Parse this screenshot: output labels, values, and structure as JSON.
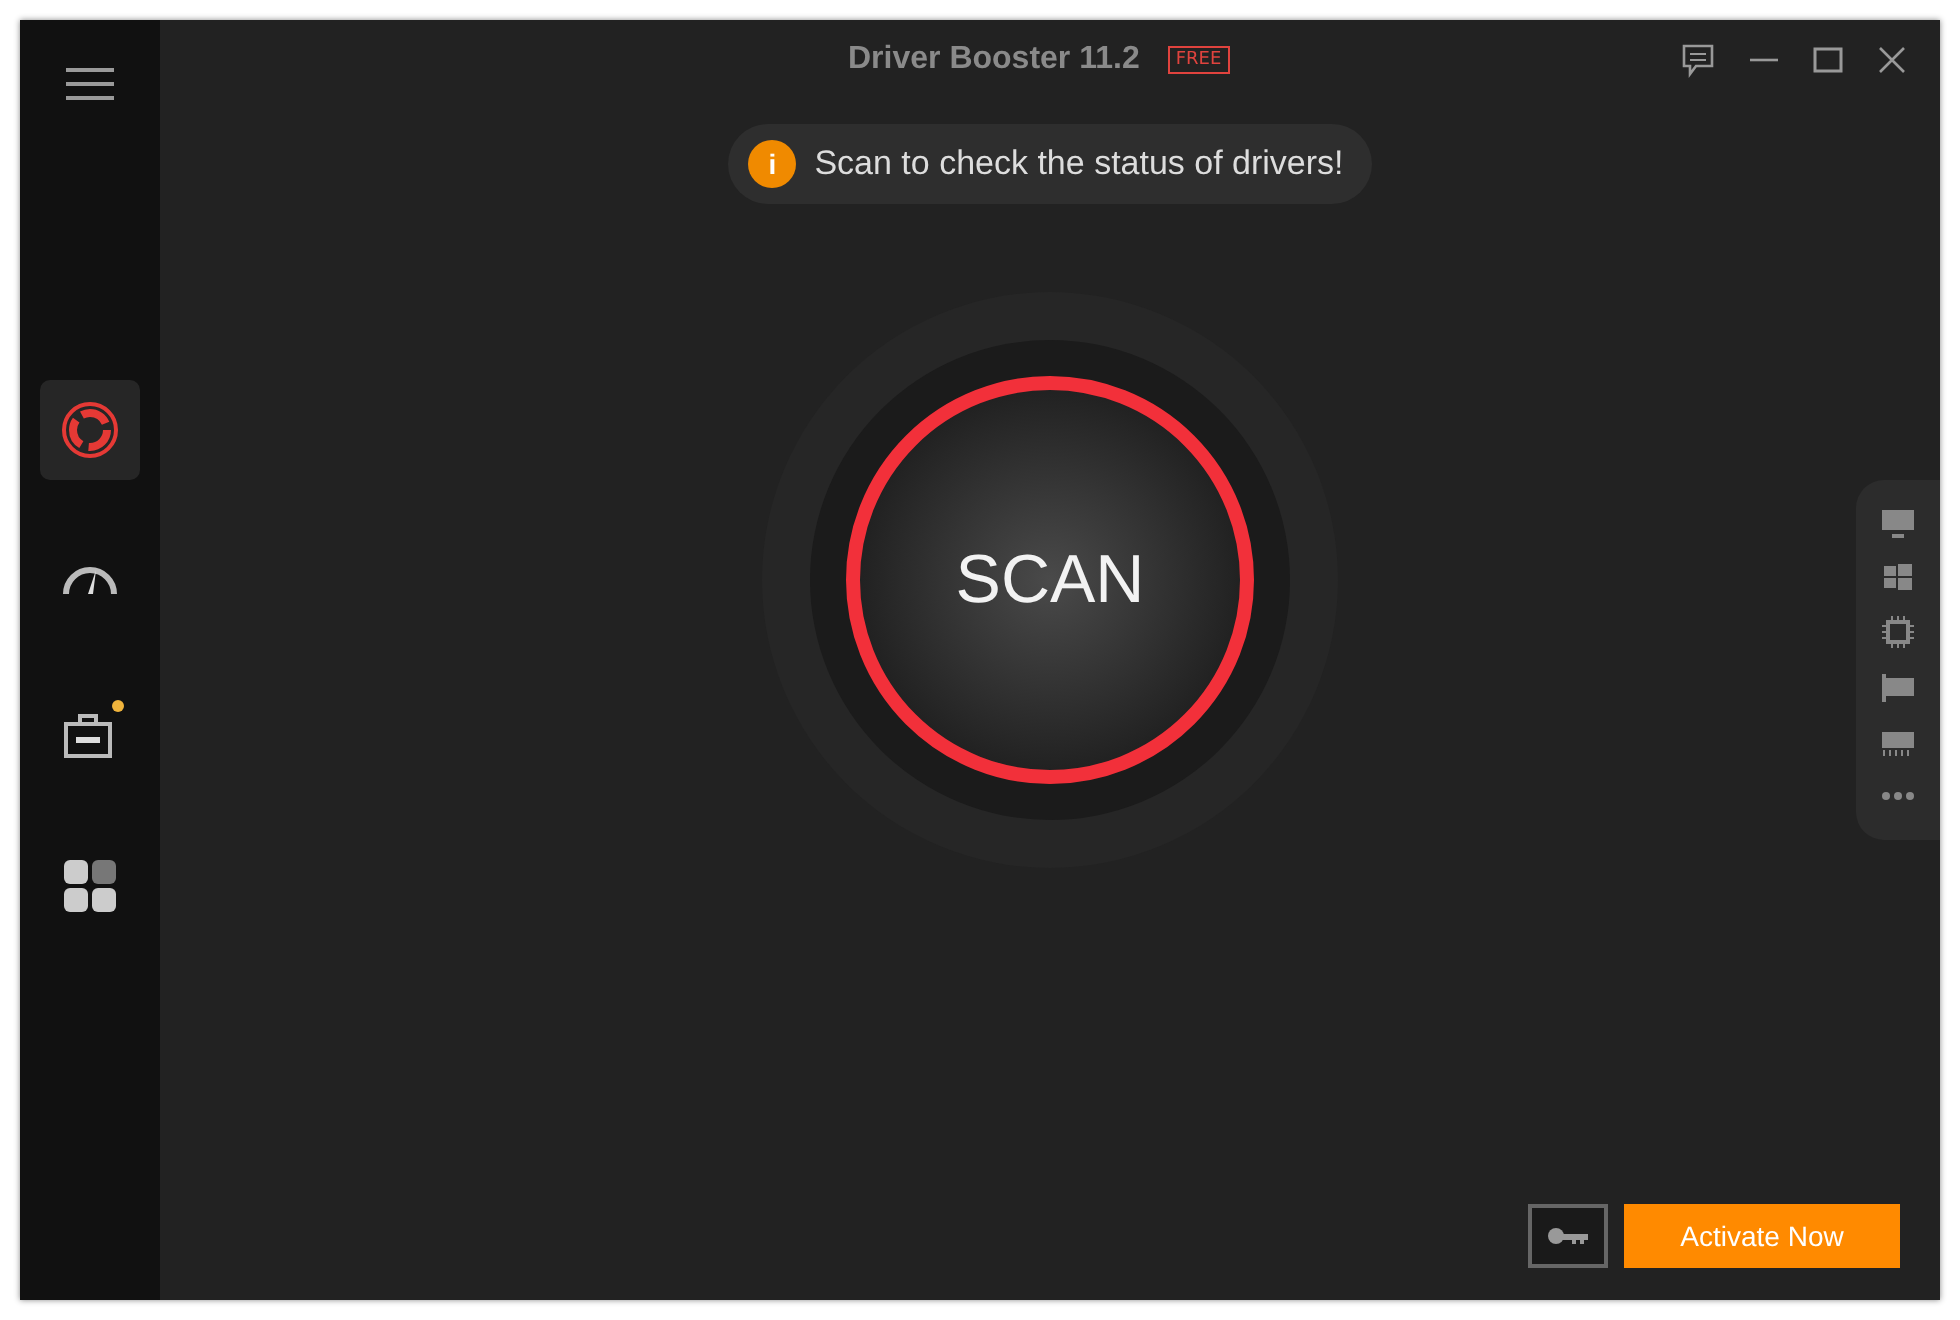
{
  "window": {
    "title": "Driver Booster 11.2",
    "edition": "FREE"
  },
  "sidebar": {
    "items": [
      {
        "kind": "scan",
        "selected": true,
        "badge": false
      },
      {
        "kind": "boost",
        "selected": false,
        "badge": false
      },
      {
        "kind": "toolbox",
        "selected": false,
        "badge": true
      },
      {
        "kind": "apps",
        "selected": false,
        "badge": false
      }
    ]
  },
  "notice": {
    "icon": "i",
    "text": "Scan to check the status of drivers!"
  },
  "scan_button": {
    "label": "SCAN"
  },
  "device_panel": {
    "items": [
      {
        "kind": "monitor"
      },
      {
        "kind": "windows"
      },
      {
        "kind": "chip"
      },
      {
        "kind": "card"
      },
      {
        "kind": "memory"
      },
      {
        "kind": "more"
      }
    ]
  },
  "footer": {
    "activate_button": "Activate Now"
  }
}
